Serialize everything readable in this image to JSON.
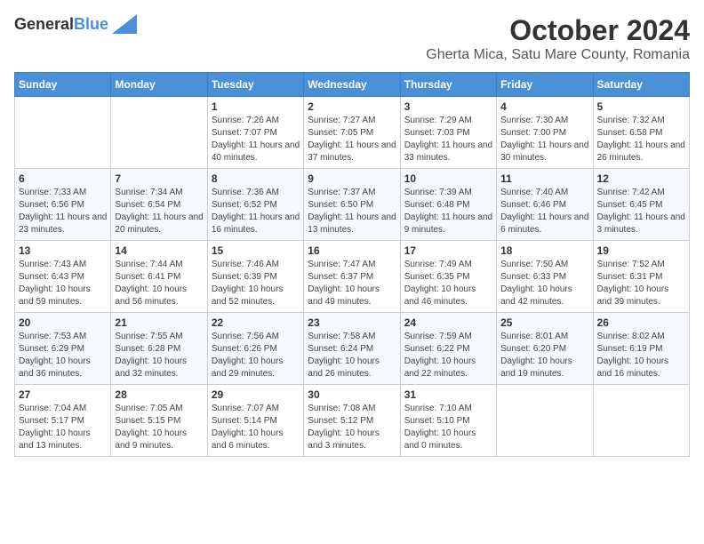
{
  "header": {
    "logo_general": "General",
    "logo_blue": "Blue",
    "title": "October 2024",
    "subtitle": "Gherta Mica, Satu Mare County, Romania"
  },
  "weekdays": [
    "Sunday",
    "Monday",
    "Tuesday",
    "Wednesday",
    "Thursday",
    "Friday",
    "Saturday"
  ],
  "weeks": [
    [
      {
        "day": "",
        "info": ""
      },
      {
        "day": "",
        "info": ""
      },
      {
        "day": "1",
        "info": "Sunrise: 7:26 AM\nSunset: 7:07 PM\nDaylight: 11 hours and 40 minutes."
      },
      {
        "day": "2",
        "info": "Sunrise: 7:27 AM\nSunset: 7:05 PM\nDaylight: 11 hours and 37 minutes."
      },
      {
        "day": "3",
        "info": "Sunrise: 7:29 AM\nSunset: 7:03 PM\nDaylight: 11 hours and 33 minutes."
      },
      {
        "day": "4",
        "info": "Sunrise: 7:30 AM\nSunset: 7:00 PM\nDaylight: 11 hours and 30 minutes."
      },
      {
        "day": "5",
        "info": "Sunrise: 7:32 AM\nSunset: 6:58 PM\nDaylight: 11 hours and 26 minutes."
      }
    ],
    [
      {
        "day": "6",
        "info": "Sunrise: 7:33 AM\nSunset: 6:56 PM\nDaylight: 11 hours and 23 minutes."
      },
      {
        "day": "7",
        "info": "Sunrise: 7:34 AM\nSunset: 6:54 PM\nDaylight: 11 hours and 20 minutes."
      },
      {
        "day": "8",
        "info": "Sunrise: 7:36 AM\nSunset: 6:52 PM\nDaylight: 11 hours and 16 minutes."
      },
      {
        "day": "9",
        "info": "Sunrise: 7:37 AM\nSunset: 6:50 PM\nDaylight: 11 hours and 13 minutes."
      },
      {
        "day": "10",
        "info": "Sunrise: 7:39 AM\nSunset: 6:48 PM\nDaylight: 11 hours and 9 minutes."
      },
      {
        "day": "11",
        "info": "Sunrise: 7:40 AM\nSunset: 6:46 PM\nDaylight: 11 hours and 6 minutes."
      },
      {
        "day": "12",
        "info": "Sunrise: 7:42 AM\nSunset: 6:45 PM\nDaylight: 11 hours and 3 minutes."
      }
    ],
    [
      {
        "day": "13",
        "info": "Sunrise: 7:43 AM\nSunset: 6:43 PM\nDaylight: 10 hours and 59 minutes."
      },
      {
        "day": "14",
        "info": "Sunrise: 7:44 AM\nSunset: 6:41 PM\nDaylight: 10 hours and 56 minutes."
      },
      {
        "day": "15",
        "info": "Sunrise: 7:46 AM\nSunset: 6:39 PM\nDaylight: 10 hours and 52 minutes."
      },
      {
        "day": "16",
        "info": "Sunrise: 7:47 AM\nSunset: 6:37 PM\nDaylight: 10 hours and 49 minutes."
      },
      {
        "day": "17",
        "info": "Sunrise: 7:49 AM\nSunset: 6:35 PM\nDaylight: 10 hours and 46 minutes."
      },
      {
        "day": "18",
        "info": "Sunrise: 7:50 AM\nSunset: 6:33 PM\nDaylight: 10 hours and 42 minutes."
      },
      {
        "day": "19",
        "info": "Sunrise: 7:52 AM\nSunset: 6:31 PM\nDaylight: 10 hours and 39 minutes."
      }
    ],
    [
      {
        "day": "20",
        "info": "Sunrise: 7:53 AM\nSunset: 6:29 PM\nDaylight: 10 hours and 36 minutes."
      },
      {
        "day": "21",
        "info": "Sunrise: 7:55 AM\nSunset: 6:28 PM\nDaylight: 10 hours and 32 minutes."
      },
      {
        "day": "22",
        "info": "Sunrise: 7:56 AM\nSunset: 6:26 PM\nDaylight: 10 hours and 29 minutes."
      },
      {
        "day": "23",
        "info": "Sunrise: 7:58 AM\nSunset: 6:24 PM\nDaylight: 10 hours and 26 minutes."
      },
      {
        "day": "24",
        "info": "Sunrise: 7:59 AM\nSunset: 6:22 PM\nDaylight: 10 hours and 22 minutes."
      },
      {
        "day": "25",
        "info": "Sunrise: 8:01 AM\nSunset: 6:20 PM\nDaylight: 10 hours and 19 minutes."
      },
      {
        "day": "26",
        "info": "Sunrise: 8:02 AM\nSunset: 6:19 PM\nDaylight: 10 hours and 16 minutes."
      }
    ],
    [
      {
        "day": "27",
        "info": "Sunrise: 7:04 AM\nSunset: 5:17 PM\nDaylight: 10 hours and 13 minutes."
      },
      {
        "day": "28",
        "info": "Sunrise: 7:05 AM\nSunset: 5:15 PM\nDaylight: 10 hours and 9 minutes."
      },
      {
        "day": "29",
        "info": "Sunrise: 7:07 AM\nSunset: 5:14 PM\nDaylight: 10 hours and 6 minutes."
      },
      {
        "day": "30",
        "info": "Sunrise: 7:08 AM\nSunset: 5:12 PM\nDaylight: 10 hours and 3 minutes."
      },
      {
        "day": "31",
        "info": "Sunrise: 7:10 AM\nSunset: 5:10 PM\nDaylight: 10 hours and 0 minutes."
      },
      {
        "day": "",
        "info": ""
      },
      {
        "day": "",
        "info": ""
      }
    ]
  ]
}
